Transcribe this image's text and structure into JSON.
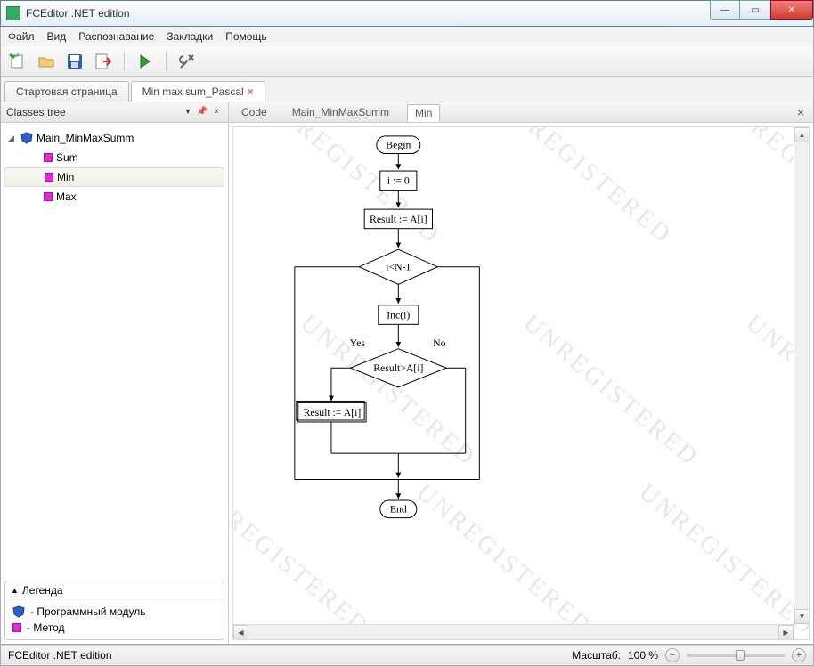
{
  "window": {
    "title": "FCEditor .NET edition"
  },
  "menu": {
    "file": "Файл",
    "view": "Вид",
    "recognize": "Распознавание",
    "bookmarks": "Закладки",
    "help": "Помощь"
  },
  "tabs": {
    "start": "Стартовая страница",
    "file": "Min max sum_Pascal"
  },
  "sidebar": {
    "title": "Classes tree",
    "root": "Main_MinMaxSumm",
    "children": [
      "Sum",
      "Min",
      "Max"
    ]
  },
  "legend": {
    "title": "Легенда",
    "module": "- Программный модуль",
    "method": "- Метод"
  },
  "subtabs": {
    "code": "Code",
    "main": "Main_MinMaxSumm",
    "min": "Min"
  },
  "flow": {
    "begin": "Begin",
    "init": "i := 0",
    "assign1": "Result := A[i]",
    "cond1": "i<N-1",
    "inc": "Inc(i)",
    "yes": "Yes",
    "no": "No",
    "cond2": "Result>A[i]",
    "assign2": "Result := A[i]",
    "end": "End"
  },
  "watermark": "UNREGISTERED",
  "status": {
    "app": "FCEditor .NET edition",
    "zoom_label": "Масштаб:",
    "zoom_value": "100 %"
  }
}
